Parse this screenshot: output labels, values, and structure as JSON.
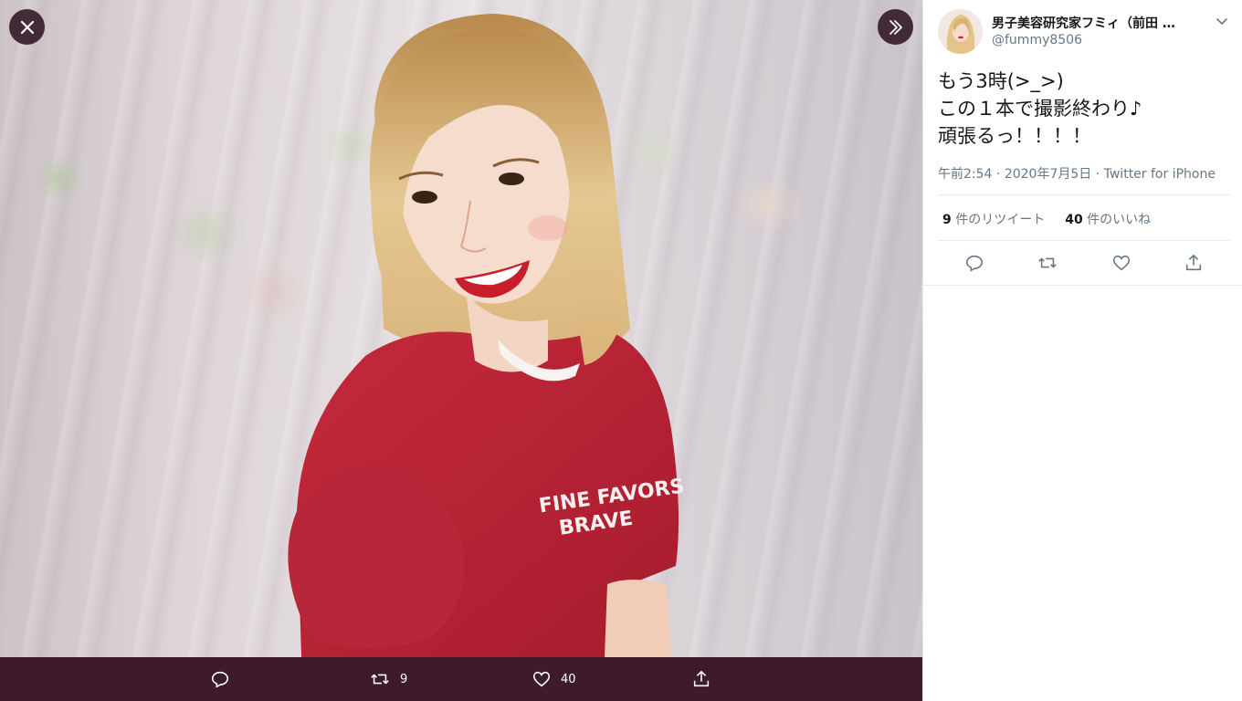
{
  "viewer": {
    "shirt_text_line1": "FINE FAVORS",
    "shirt_text_line2": "BRAVE",
    "bar": {
      "retweet_count": "9",
      "like_count": "40"
    }
  },
  "tweet": {
    "author_name": "男子美容研究家フミィ（前田 …",
    "author_handle": "@fummy8506",
    "text_lines": [
      "もう3時(>_>)",
      "この１本で撮影終わり♪",
      "頑張るっ！！！！"
    ],
    "time": "午前2:54",
    "date": "2020年7月5日",
    "separator": "·",
    "source": "Twitter for iPhone",
    "retweets": {
      "count": "9",
      "label": "件のリツイート"
    },
    "likes": {
      "count": "40",
      "label": "件のいいね"
    }
  },
  "colors": {
    "viewer_bar": "#3d1b2b",
    "text_primary": "#14171a",
    "text_secondary": "#657786",
    "icon": "#657786"
  },
  "icons": [
    "close-icon",
    "next-icon",
    "reply-icon",
    "retweet-icon",
    "like-icon",
    "share-icon",
    "chevron-down-icon"
  ]
}
